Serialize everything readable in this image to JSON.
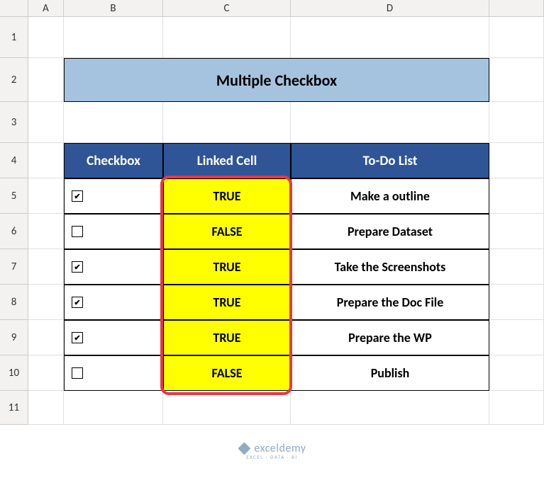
{
  "columns": [
    "A",
    "B",
    "C",
    "D"
  ],
  "row_numbers": [
    "1",
    "2",
    "3",
    "4",
    "5",
    "6",
    "7",
    "8",
    "9",
    "10",
    "11"
  ],
  "title": "Multiple Checkbox",
  "headers": {
    "checkbox": "Checkbox",
    "linked_cell": "Linked Cell",
    "todo": "To-Do List"
  },
  "rows": [
    {
      "checked": true,
      "linked": "TRUE",
      "todo": "Make a outline"
    },
    {
      "checked": false,
      "linked": "FALSE",
      "todo": "Prepare Dataset"
    },
    {
      "checked": true,
      "linked": "TRUE",
      "todo": "Take the Screenshots"
    },
    {
      "checked": true,
      "linked": "TRUE",
      "todo": "Prepare the Doc File"
    },
    {
      "checked": true,
      "linked": "TRUE",
      "todo": "Prepare the WP"
    },
    {
      "checked": false,
      "linked": "FALSE",
      "todo": "Publish"
    }
  ],
  "watermark": {
    "name": "exceldemy",
    "tagline": "EXCEL · DATA · BI"
  },
  "chart_data": {
    "type": "table",
    "title": "Multiple Checkbox",
    "columns": [
      "Checkbox",
      "Linked Cell",
      "To-Do List"
    ],
    "rows": [
      [
        "checked",
        "TRUE",
        "Make a outline"
      ],
      [
        "unchecked",
        "FALSE",
        "Prepare Dataset"
      ],
      [
        "checked",
        "TRUE",
        "Take the Screenshots"
      ],
      [
        "checked",
        "TRUE",
        "Prepare the Doc File"
      ],
      [
        "checked",
        "TRUE",
        "Prepare the WP"
      ],
      [
        "unchecked",
        "FALSE",
        "Publish"
      ]
    ]
  }
}
